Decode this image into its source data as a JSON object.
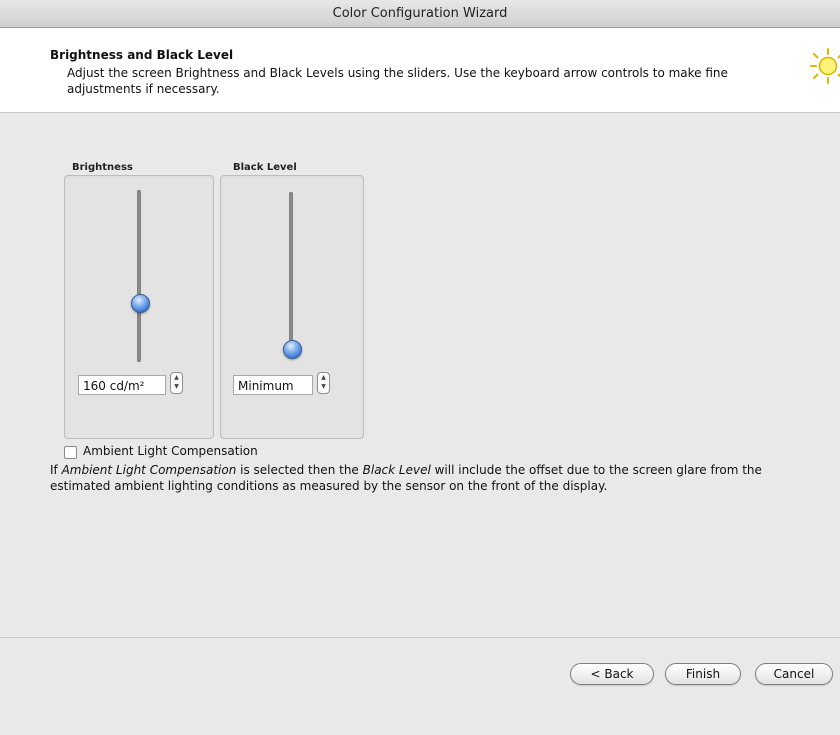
{
  "window": {
    "title": "Color Configuration Wizard"
  },
  "header": {
    "title": "Brightness and Black Level",
    "description": "Adjust the screen Brightness and Black Levels using the sliders. Use the keyboard arrow controls to make fine adjustments if necessary.",
    "icon": "sun-icon"
  },
  "brightness": {
    "label": "Brightness",
    "value": "160 cd/m²",
    "slider_level": 0.58
  },
  "black_level": {
    "label": "Black Level",
    "value": "Minimum",
    "slider_level": 0.0
  },
  "ambient": {
    "label": "Ambient Light Compensation",
    "checked": false,
    "explain_part1": "If ",
    "explain_italic1": "Ambient Light Compensation",
    "explain_part2": " is selected then the ",
    "explain_italic2": "Black Level",
    "explain_part3": " will include the offset due to the screen glare from the estimated ambient lighting conditions as measured by the sensor on the front of the display."
  },
  "buttons": {
    "back": "< Back",
    "finish": "Finish",
    "cancel": "Cancel"
  },
  "colors": {
    "knob": "#2f6fd1",
    "header_bg": "#ffffff",
    "panel_bg": "#e3e3e3"
  }
}
